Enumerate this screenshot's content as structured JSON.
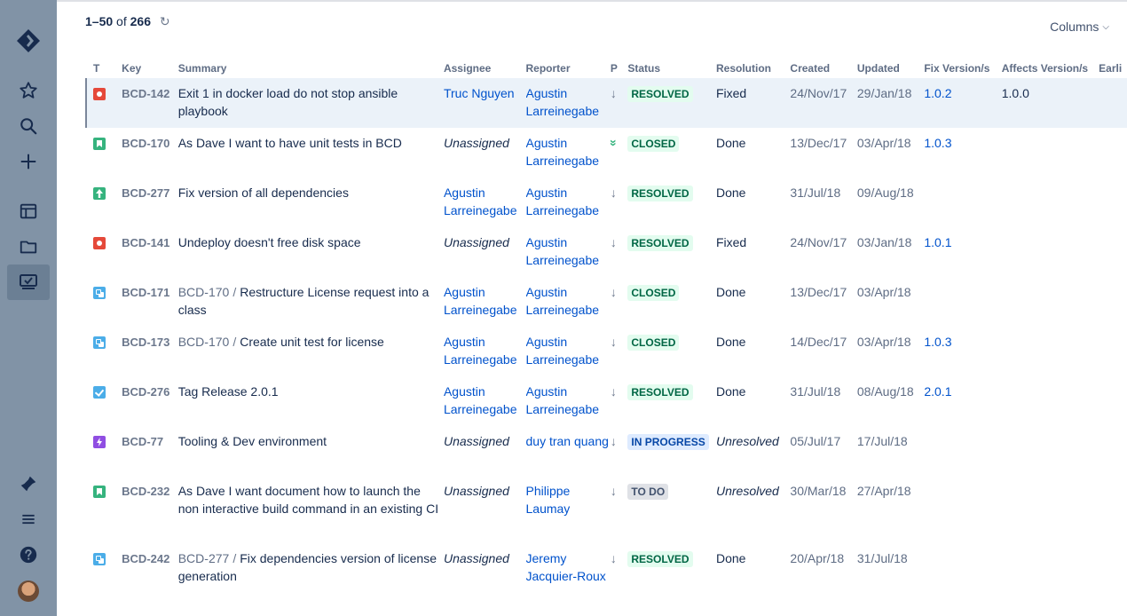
{
  "sidebar": {
    "icons": [
      "jira-logo-icon",
      "star-icon",
      "search-icon",
      "plus-icon",
      "board-icon",
      "folder-icon",
      "issues-icon",
      "notifications-icon",
      "menu-icon",
      "help-icon",
      "avatar"
    ]
  },
  "results": {
    "range": "1–50",
    "of_label": "of",
    "total": "266"
  },
  "columns_button": {
    "label": "Columns"
  },
  "table": {
    "headers": {
      "t": "T",
      "key": "Key",
      "summary": "Summary",
      "assignee": "Assignee",
      "reporter": "Reporter",
      "p": "P",
      "status": "Status",
      "resolution": "Resolution",
      "created": "Created",
      "updated": "Updated",
      "fix": "Fix Version/s",
      "affects": "Affects Version/s",
      "earliest": "Earli"
    },
    "rows": [
      {
        "type": "bug",
        "key": "BCD-142",
        "parent": "",
        "summary": "Exit 1 in docker load do not stop ansible playbook",
        "assignee": "Truc Nguyen",
        "reporter": "Agustin Larreinegabe",
        "priority": "low",
        "status": "RESOLVED",
        "status_cat": "done",
        "resolution": "Fixed",
        "created": "24/Nov/17",
        "updated": "29/Jan/18",
        "fix": "1.0.2",
        "affects": "1.0.0"
      },
      {
        "type": "story",
        "key": "BCD-170",
        "parent": "",
        "summary": "As Dave I want to have unit tests in BCD",
        "assignee": "Unassigned",
        "reporter": "Agustin Larreinegabe",
        "priority": "high",
        "status": "CLOSED",
        "status_cat": "done",
        "resolution": "Done",
        "created": "13/Dec/17",
        "updated": "03/Apr/18",
        "fix": "1.0.3",
        "affects": ""
      },
      {
        "type": "improvement",
        "key": "BCD-277",
        "parent": "",
        "summary": "Fix version of all dependencies",
        "assignee": "Agustin Larreinegabe",
        "reporter": "Agustin Larreinegabe",
        "priority": "low",
        "status": "RESOLVED",
        "status_cat": "done",
        "resolution": "Done",
        "created": "31/Jul/18",
        "updated": "09/Aug/18",
        "fix": "",
        "affects": ""
      },
      {
        "type": "bug",
        "key": "BCD-141",
        "parent": "",
        "summary": "Undeploy doesn't free disk space",
        "assignee": "Unassigned",
        "reporter": "Agustin Larreinegabe",
        "priority": "low",
        "status": "RESOLVED",
        "status_cat": "done",
        "resolution": "Fixed",
        "created": "24/Nov/17",
        "updated": "03/Jan/18",
        "fix": "1.0.1",
        "affects": ""
      },
      {
        "type": "subtask",
        "key": "BCD-171",
        "parent": "BCD-170",
        "summary": "Restructure License request into a class",
        "assignee": "Agustin Larreinegabe",
        "reporter": "Agustin Larreinegabe",
        "priority": "low",
        "status": "CLOSED",
        "status_cat": "done",
        "resolution": "Done",
        "created": "13/Dec/17",
        "updated": "03/Apr/18",
        "fix": "",
        "affects": ""
      },
      {
        "type": "subtask",
        "key": "BCD-173",
        "parent": "BCD-170",
        "summary": "Create unit test for license",
        "assignee": "Agustin Larreinegabe",
        "reporter": "Agustin Larreinegabe",
        "priority": "low",
        "status": "CLOSED",
        "status_cat": "done",
        "resolution": "Done",
        "created": "14/Dec/17",
        "updated": "03/Apr/18",
        "fix": "1.0.3",
        "affects": ""
      },
      {
        "type": "task",
        "key": "BCD-276",
        "parent": "",
        "summary": "Tag Release 2.0.1",
        "assignee": "Agustin Larreinegabe",
        "reporter": "Agustin Larreinegabe",
        "priority": "low",
        "status": "RESOLVED",
        "status_cat": "done",
        "resolution": "Done",
        "created": "31/Jul/18",
        "updated": "08/Aug/18",
        "fix": "2.0.1",
        "affects": ""
      },
      {
        "type": "epic",
        "key": "BCD-77",
        "parent": "",
        "summary": "Tooling & Dev environment",
        "assignee": "Unassigned",
        "reporter": "duy tran quang",
        "priority": "low",
        "status": "IN PROGRESS",
        "status_cat": "inprogress",
        "resolution": "Unresolved",
        "created": "05/Jul/17",
        "updated": "17/Jul/18",
        "fix": "",
        "affects": ""
      },
      {
        "type": "story",
        "key": "BCD-232",
        "parent": "",
        "summary": "As Dave I want document how to launch the non interactive build command in an existing CI",
        "assignee": "Unassigned",
        "reporter": "Philippe Laumay",
        "priority": "low",
        "status": "TO DO",
        "status_cat": "todo",
        "resolution": "Unresolved",
        "created": "30/Mar/18",
        "updated": "27/Apr/18",
        "fix": "",
        "affects": ""
      },
      {
        "type": "subtask",
        "key": "BCD-242",
        "parent": "BCD-277",
        "summary": "Fix dependencies version of license generation",
        "assignee": "Unassigned",
        "reporter": "Jeremy Jacquier-Roux",
        "priority": "low",
        "status": "RESOLVED",
        "status_cat": "done",
        "resolution": "Done",
        "created": "20/Apr/18",
        "updated": "31/Jul/18",
        "fix": "",
        "affects": ""
      }
    ]
  }
}
